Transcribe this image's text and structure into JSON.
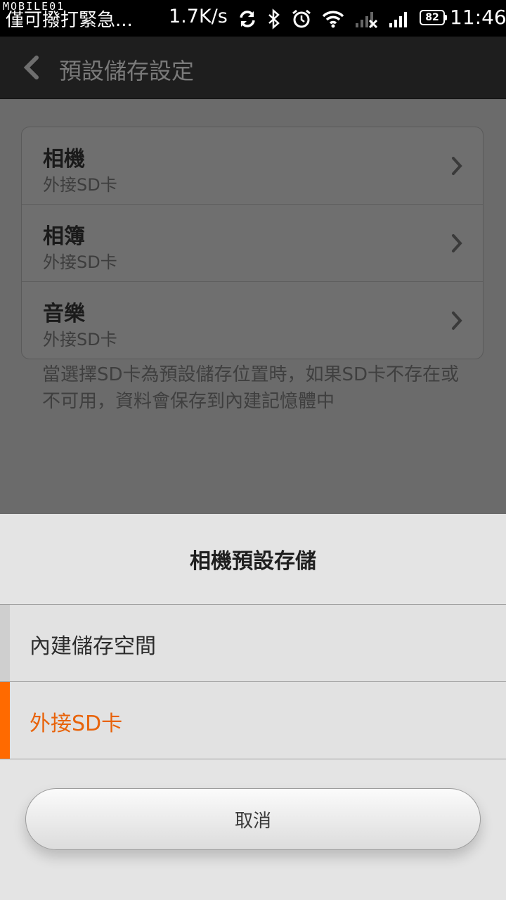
{
  "status_bar": {
    "watermark": "MOBILE01",
    "carrier": "僅可撥打緊急...",
    "speed": "1.7K/s",
    "icons": [
      "sync-icon",
      "bluetooth-icon",
      "alarm-icon",
      "wifi-icon",
      "no-signal-icon",
      "signal-icon"
    ],
    "battery": "82",
    "time": "11:46"
  },
  "title_bar": {
    "title": "預設儲存設定"
  },
  "settings": {
    "items": [
      {
        "title": "相機",
        "value": "外接SD卡"
      },
      {
        "title": "相簿",
        "value": "外接SD卡"
      },
      {
        "title": "音樂",
        "value": "外接SD卡"
      }
    ],
    "hint": "當選擇SD卡為預設儲存位置時，如果SD卡不存在或不可用，資料會保存到內建記憶體中"
  },
  "sheet": {
    "title": "相機預設存儲",
    "options": [
      {
        "label": "內建儲存空間",
        "selected": false
      },
      {
        "label": "外接SD卡",
        "selected": true
      }
    ],
    "cancel_label": "取消"
  },
  "colors": {
    "accent": "#ff6a00",
    "selected_text": "#e8630a"
  }
}
